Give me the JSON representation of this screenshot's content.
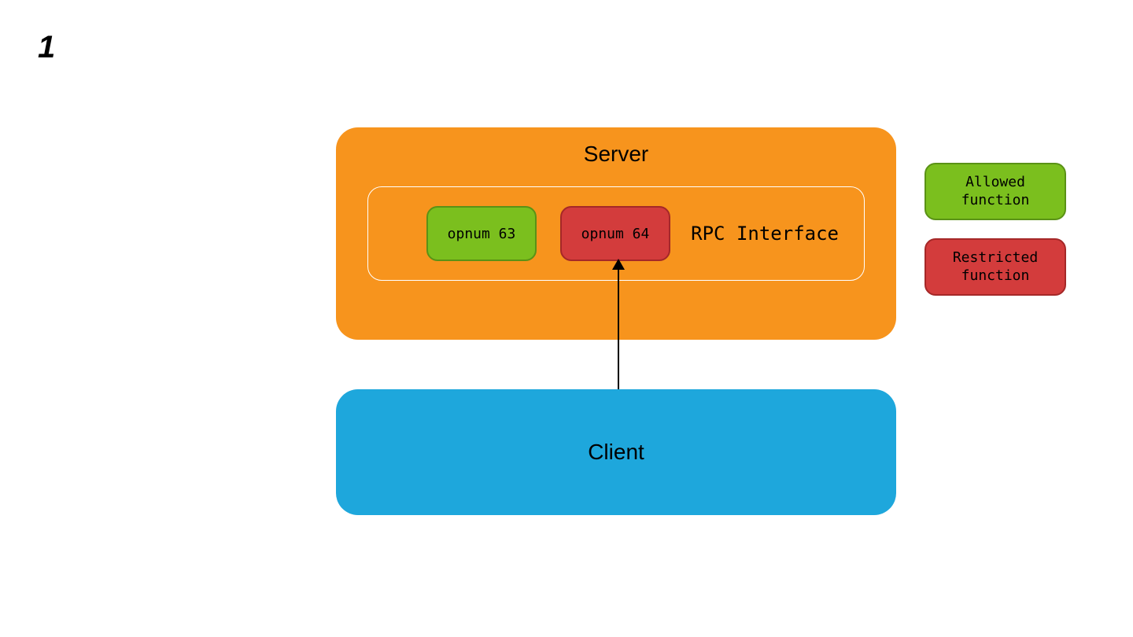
{
  "step_number": "1",
  "server": {
    "label": "Server",
    "rpc_interface_label": "RPC Interface",
    "opnum_allowed": "opnum 63",
    "opnum_restricted": "opnum 64"
  },
  "client": {
    "label": "Client"
  },
  "legend": {
    "allowed_line1": "Allowed",
    "allowed_line2": "function",
    "restricted_line1": "Restricted",
    "restricted_line2": "function"
  },
  "colors": {
    "server_bg": "#f7941d",
    "client_bg": "#1ea7dc",
    "allowed_bg": "#7bbf1e",
    "restricted_bg": "#d33c3c"
  },
  "arrow": {
    "from": "Client",
    "to": "opnum 64"
  }
}
